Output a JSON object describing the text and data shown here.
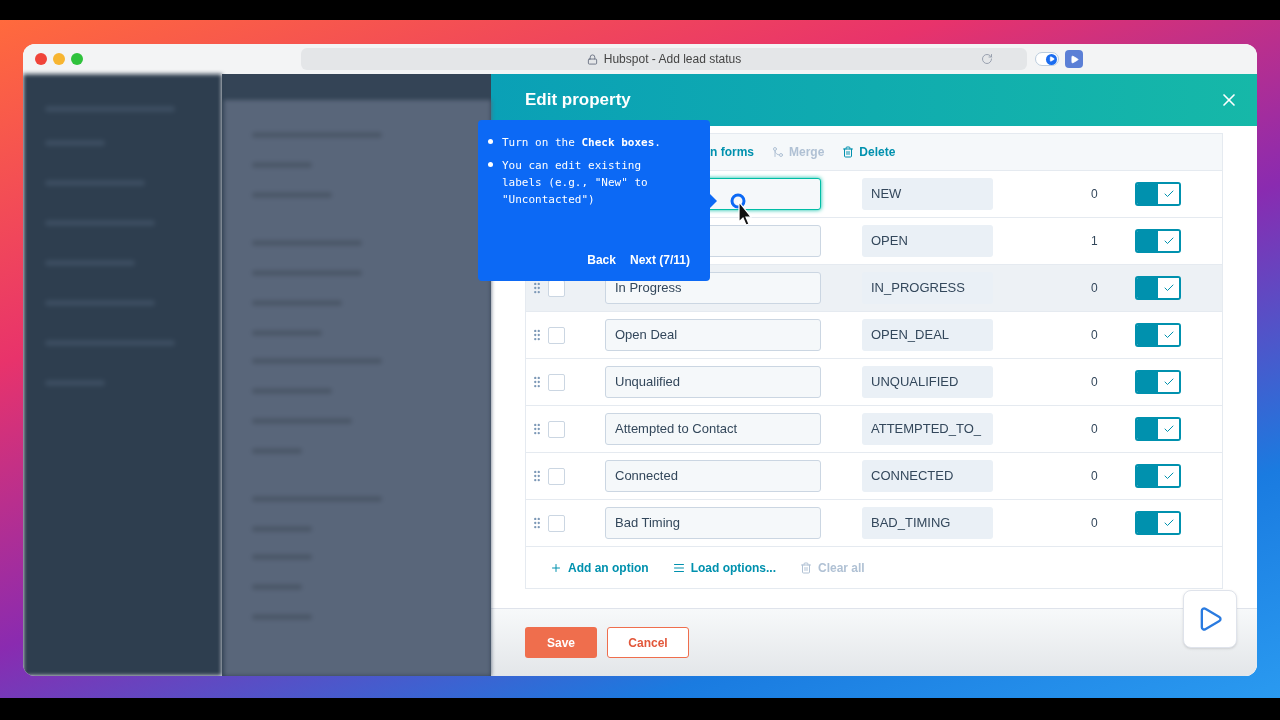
{
  "window": {
    "title": "Hubspot - Add lead status"
  },
  "modal": {
    "title": "Edit property",
    "toolbar": [
      {
        "label": "n forms",
        "disabled": false
      },
      {
        "label": "Merge",
        "disabled": true
      },
      {
        "label": "Delete",
        "disabled": false
      }
    ],
    "options": [
      {
        "internal_name": "NEW",
        "count": "0",
        "on": true,
        "hovered": false,
        "focused": true
      },
      {
        "internal_name": "OPEN",
        "count": "1",
        "on": true,
        "hovered": false,
        "focused": false
      },
      {
        "label": "In Progress",
        "checked": false,
        "internal_name": "IN_PROGRESS",
        "count": "0",
        "on": true,
        "hovered": true,
        "focused": false
      },
      {
        "label": "Open Deal",
        "checked": false,
        "internal_name": "OPEN_DEAL",
        "count": "0",
        "on": true,
        "hovered": false,
        "focused": false
      },
      {
        "label": "Unqualified",
        "checked": false,
        "internal_name": "UNQUALIFIED",
        "count": "0",
        "on": true,
        "hovered": false,
        "focused": false
      },
      {
        "label": "Attempted to Contact",
        "checked": false,
        "internal_name": "ATTEMPTED_TO_",
        "count": "0",
        "on": true,
        "hovered": false,
        "focused": false
      },
      {
        "label": "Connected",
        "checked": false,
        "internal_name": "CONNECTED",
        "count": "0",
        "on": true,
        "hovered": false,
        "focused": false
      },
      {
        "label": "Bad Timing",
        "checked": false,
        "internal_name": "BAD_TIMING",
        "count": "0",
        "on": true,
        "hovered": false,
        "focused": false
      }
    ],
    "option_actions": [
      {
        "label": "Add an option",
        "disabled": false
      },
      {
        "label": "Load options...",
        "disabled": false
      },
      {
        "label": "Clear all",
        "disabled": true
      }
    ],
    "save": "Save",
    "cancel": "Cancel"
  },
  "tooltip": {
    "bullets": [
      "Turn on the **Check boxes**.",
      "You can edit existing labels (e.g., \"New\" to \"Uncontacted\")"
    ],
    "back": "Back",
    "next": "Next (7/11)"
  }
}
